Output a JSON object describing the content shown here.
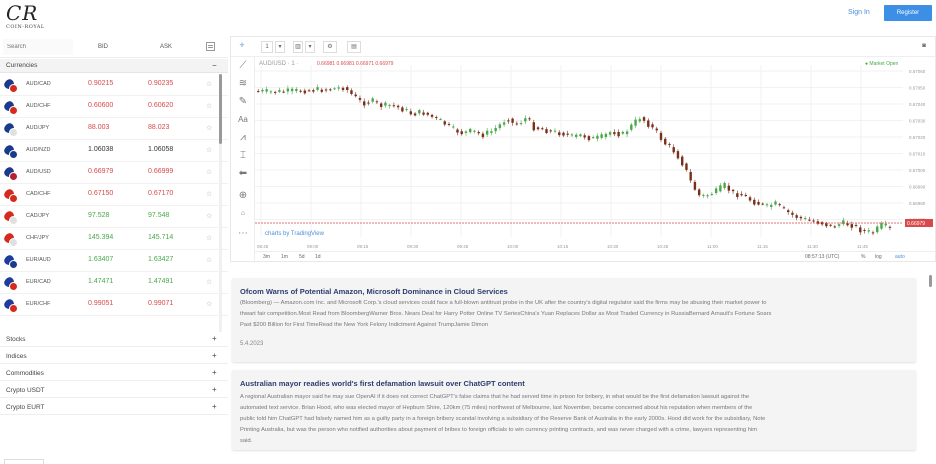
{
  "header": {
    "logo_main": "CR",
    "logo_sub": "COIN-ROYAL",
    "signin_label": "Sign In",
    "register_label": "Register",
    "brand_color": "#3d8fe6"
  },
  "sidebar": {
    "search_placeholder": "Search",
    "bid_header": "BID",
    "ask_header": "ASK",
    "open_category": {
      "label": "Currencies",
      "toggle": "−"
    },
    "rows": [
      {
        "pair": "AUD/CAD",
        "bid": "0.90215",
        "ask": "0.90235",
        "color": "red",
        "flags": [
          "#1a3a8c",
          "#d52b1e"
        ]
      },
      {
        "pair": "AUD/CHF",
        "bid": "0.60600",
        "ask": "0.60620",
        "color": "red",
        "flags": [
          "#1a3a8c",
          "#d52b1e"
        ]
      },
      {
        "pair": "AUD/JPY",
        "bid": "88.003",
        "ask": "88.023",
        "color": "red",
        "flags": [
          "#1a3a8c",
          "#e0e0e0"
        ]
      },
      {
        "pair": "AUD/NZD",
        "bid": "1.06038",
        "ask": "1.06058",
        "color": "dark",
        "flags": [
          "#1a3a8c",
          "#1a3a8c"
        ]
      },
      {
        "pair": "AUD/USD",
        "bid": "0.66979",
        "ask": "0.66999",
        "color": "red",
        "flags": [
          "#1a3a8c",
          "#b22234"
        ]
      },
      {
        "pair": "CAD/CHF",
        "bid": "0.67150",
        "ask": "0.67170",
        "color": "red",
        "flags": [
          "#d52b1e",
          "#d52b1e"
        ]
      },
      {
        "pair": "CAD/JPY",
        "bid": "97.528",
        "ask": "97.548",
        "color": "green",
        "flags": [
          "#d52b1e",
          "#e0e0e0"
        ]
      },
      {
        "pair": "CHF/JPY",
        "bid": "145.394",
        "ask": "145.714",
        "color": "green",
        "flags": [
          "#d52b1e",
          "#e0e0e0"
        ]
      },
      {
        "pair": "EUR/AUD",
        "bid": "1.63407",
        "ask": "1.63427",
        "color": "green",
        "flags": [
          "#1f3c9c",
          "#1a3a8c"
        ]
      },
      {
        "pair": "EUR/CAD",
        "bid": "1.47471",
        "ask": "1.47491",
        "color": "green",
        "flags": [
          "#1f3c9c",
          "#d52b1e"
        ]
      },
      {
        "pair": "EUR/CHF",
        "bid": "0.99051",
        "ask": "0.99071",
        "color": "red",
        "flags": [
          "#1f3c9c",
          "#d52b1e"
        ]
      }
    ],
    "star": "☆",
    "categories": [
      {
        "label": "Stocks",
        "toggle": "+"
      },
      {
        "label": "Indices",
        "toggle": "+"
      },
      {
        "label": "Commodities",
        "toggle": "+"
      },
      {
        "label": "Crypto USDT",
        "toggle": "+"
      },
      {
        "label": "Crypto EURT",
        "toggle": "+"
      }
    ]
  },
  "chart": {
    "symbol": "AUD/USD · 1 ·",
    "ohlc": "0.66981  0.66981  0.66971  0.66979",
    "market_status": "● Market Open",
    "interval_btn": "1",
    "watermark": "charts by TradingView",
    "current_price_label": "0.66979",
    "price_line_color": "#d84a4a",
    "up_color": "#49a84a",
    "down_color": "#7a2f1a",
    "timeframes": [
      "3m",
      "1m",
      "5d",
      "1d"
    ],
    "right_controls": [
      "08:57:13 (UTC)",
      "%",
      "log",
      "auto"
    ],
    "time_labels": [
      "08:45",
      "09:00",
      "09:15",
      "09:30",
      "09:45",
      "10:00",
      "10:15",
      "10:30",
      "10:45",
      "11:00",
      "11:15",
      "11:30",
      "11:45"
    ],
    "price_labels": [
      "0.67060",
      "0.67050",
      "0.67040",
      "0.67030",
      "0.67020",
      "0.67010",
      "0.67000",
      "0.66990",
      "0.66980",
      "0.66970"
    ]
  },
  "news": [
    {
      "title": "Ofcom Warns of Potential Amazon, Microsoft Dominance in Cloud Services",
      "lines": [
        "(Bloomberg) — Amazon.com Inc. and Microsoft Corp.'s cloud services could face a full-blown antitrust probe in the UK after the country's digital regulator said the firms may be abusing their market power to",
        "thwart fair competition.Most Read from BloombergWarner Bros. Nears Deal for Harry Potter Online TV SeriesChina's Yuan Replaces Dollar as Most Traded Currency in RussiaBernard Arnault's Fortune Soars",
        "Past $200 Billion for First TimeRead the New York Felony Indictment Against TrumpJamie Dimon"
      ],
      "date": "5.4.2023"
    },
    {
      "title": "Australian mayor readies world's first defamation lawsuit over ChatGPT content",
      "lines": [
        "A regional Australian mayor said he may sue OpenAI if it does not correct ChatGPT's false claims that he had served time in prison for bribery, in what would be the first defamation lawsuit against the",
        "automated text service. Brian Hood, who was elected mayor of Hepburn Shire, 120km (75 miles) northwest of Melbourne, last November, became concerned about his reputation when members of the",
        "public told him ChatGPT had falsely named him as a guilty party in a foreign bribery scandal involving a subsidiary of the Reserve Bank of Australia in the early 2000s. Hood did work for the subsidiary, Note",
        "Printing Australia, but was the person who notified authorities about payment of bribes to foreign officials to win currency printing contracts, and was never charged with a crime, lawyers representing him",
        "said."
      ]
    }
  ]
}
